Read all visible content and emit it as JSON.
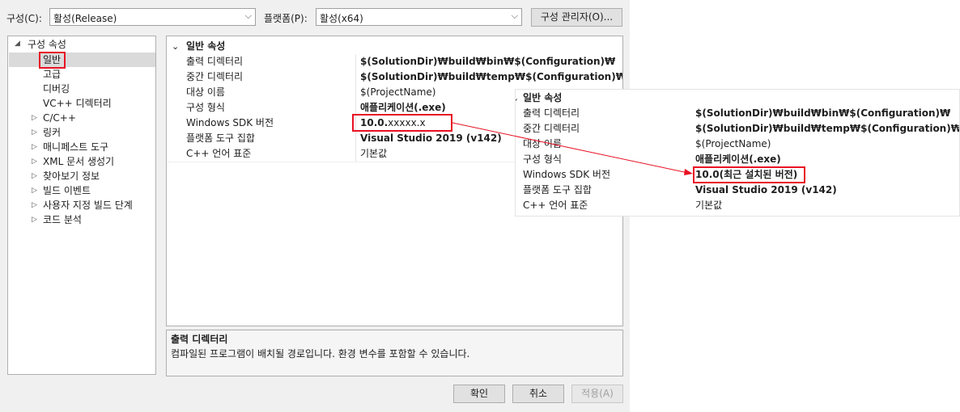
{
  "toolbar": {
    "config_label": "구성(C):",
    "config_value": "활성(Release)",
    "platform_label": "플랫폼(P):",
    "platform_value": "활성(x64)",
    "config_manager_button": "구성 관리자(O)..."
  },
  "tree": {
    "root": "구성 속성",
    "items": [
      {
        "label": "일반",
        "selected": true
      },
      {
        "label": "고급"
      },
      {
        "label": "디버깅"
      },
      {
        "label": "VC++ 디렉터리"
      },
      {
        "label": "C/C++"
      },
      {
        "label": "링커"
      },
      {
        "label": "매니페스트 도구"
      },
      {
        "label": "XML 문서 생성기"
      },
      {
        "label": "찾아보기 정보"
      },
      {
        "label": "빌드 이벤트"
      },
      {
        "label": "사용자 지정 빌드 단계"
      },
      {
        "label": "코드 분석"
      }
    ]
  },
  "grid": {
    "category": "일반 속성",
    "rows": [
      {
        "name": "출력 디렉터리",
        "value": "$(SolutionDir)₩build₩bin₩$(Configuration)₩"
      },
      {
        "name": "중간 디렉터리",
        "value": "$(SolutionDir)₩build₩temp₩$(Configuration)₩$(MSBuild"
      },
      {
        "name": "대상 이름",
        "value": "$(ProjectName)"
      },
      {
        "name": "구성 형식",
        "value": "애플리케이션(.exe)"
      },
      {
        "name": "Windows SDK 버전",
        "value_bold": "10.0.",
        "value_rest": "xxxxx.x"
      },
      {
        "name": "플랫폼 도구 집합",
        "value": "Visual Studio 2019 (v142)"
      },
      {
        "name": "C++ 언어 표준",
        "value": "기본값"
      }
    ]
  },
  "description": {
    "title": "출력 디렉터리",
    "text": "컴파일된 프로그램이 배치될 경로입니다. 환경 변수를 포함할 수 있습니다."
  },
  "buttons": {
    "ok": "확인",
    "cancel": "취소",
    "apply": "적용(A)"
  },
  "zoom": {
    "category": "일반 속성",
    "rows": [
      {
        "name": "출력 디렉터리",
        "value": "$(SolutionDir)₩build₩bin₩$(Configuration)₩"
      },
      {
        "name": "중간 디렉터리",
        "value": "$(SolutionDir)₩build₩temp₩$(Configuration)₩$(MSBuild"
      },
      {
        "name": "대상 이름",
        "value": "$(ProjectName)"
      },
      {
        "name": "구성 형식",
        "value": "애플리케이션(.exe)"
      },
      {
        "name": "Windows SDK 버전",
        "value": "10.0(최근 설치된 버전)"
      },
      {
        "name": "플랫폼 도구 집합",
        "value": "Visual Studio 2019 (v142)"
      },
      {
        "name": "C++ 언어 표준",
        "value": "기본값"
      }
    ]
  },
  "colors": {
    "highlight": "#e81123",
    "selection": "#dadada"
  }
}
